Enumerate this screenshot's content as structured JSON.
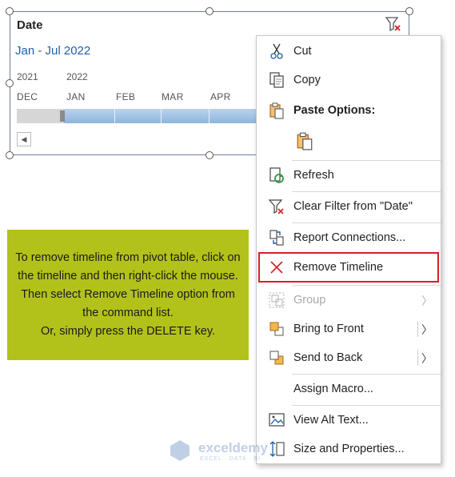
{
  "timeline": {
    "title": "Date",
    "range": "Jan - Jul 2022",
    "years": [
      "2021",
      "2022"
    ],
    "months": [
      "DEC",
      "JAN",
      "FEB",
      "MAR",
      "APR"
    ],
    "scroll_left": "◀"
  },
  "note": {
    "text": "To remove timeline from pivot table, click on the timeline and then right-click the mouse. Then  select Remove Timeline option from the command list.\nOr, simply press the DELETE key."
  },
  "menu": {
    "items": [
      {
        "label": "Cut",
        "icon": "scissors-icon"
      },
      {
        "label": "Copy",
        "icon": "copy-icon"
      },
      {
        "label": "Paste Options:",
        "icon": "paste-icon"
      },
      {
        "label": "Refresh",
        "icon": "refresh-icon"
      },
      {
        "label": "Clear Filter from \"Date\"",
        "icon": "clear-filter-icon"
      },
      {
        "label": "Report Connections...",
        "icon": "report-connections-icon"
      },
      {
        "label": "Remove Timeline",
        "icon": "remove-x-icon"
      },
      {
        "label": "Group",
        "icon": "group-icon",
        "disabled": true
      },
      {
        "label": "Bring to Front",
        "icon": "bring-front-icon"
      },
      {
        "label": "Send to Back",
        "icon": "send-back-icon"
      },
      {
        "label": "Assign Macro...",
        "icon": ""
      },
      {
        "label": "View Alt Text...",
        "icon": "alt-text-icon"
      },
      {
        "label": "Size and Properties...",
        "icon": "size-properties-icon"
      }
    ],
    "submenu_arrow": "〉"
  },
  "watermark": {
    "name": "exceldemy",
    "tagline": "EXCEL · DATA · BI"
  },
  "colors": {
    "accent_blue": "#1f5fa8",
    "note_bg": "#b3c21a",
    "highlight_red": "#d81e28"
  }
}
